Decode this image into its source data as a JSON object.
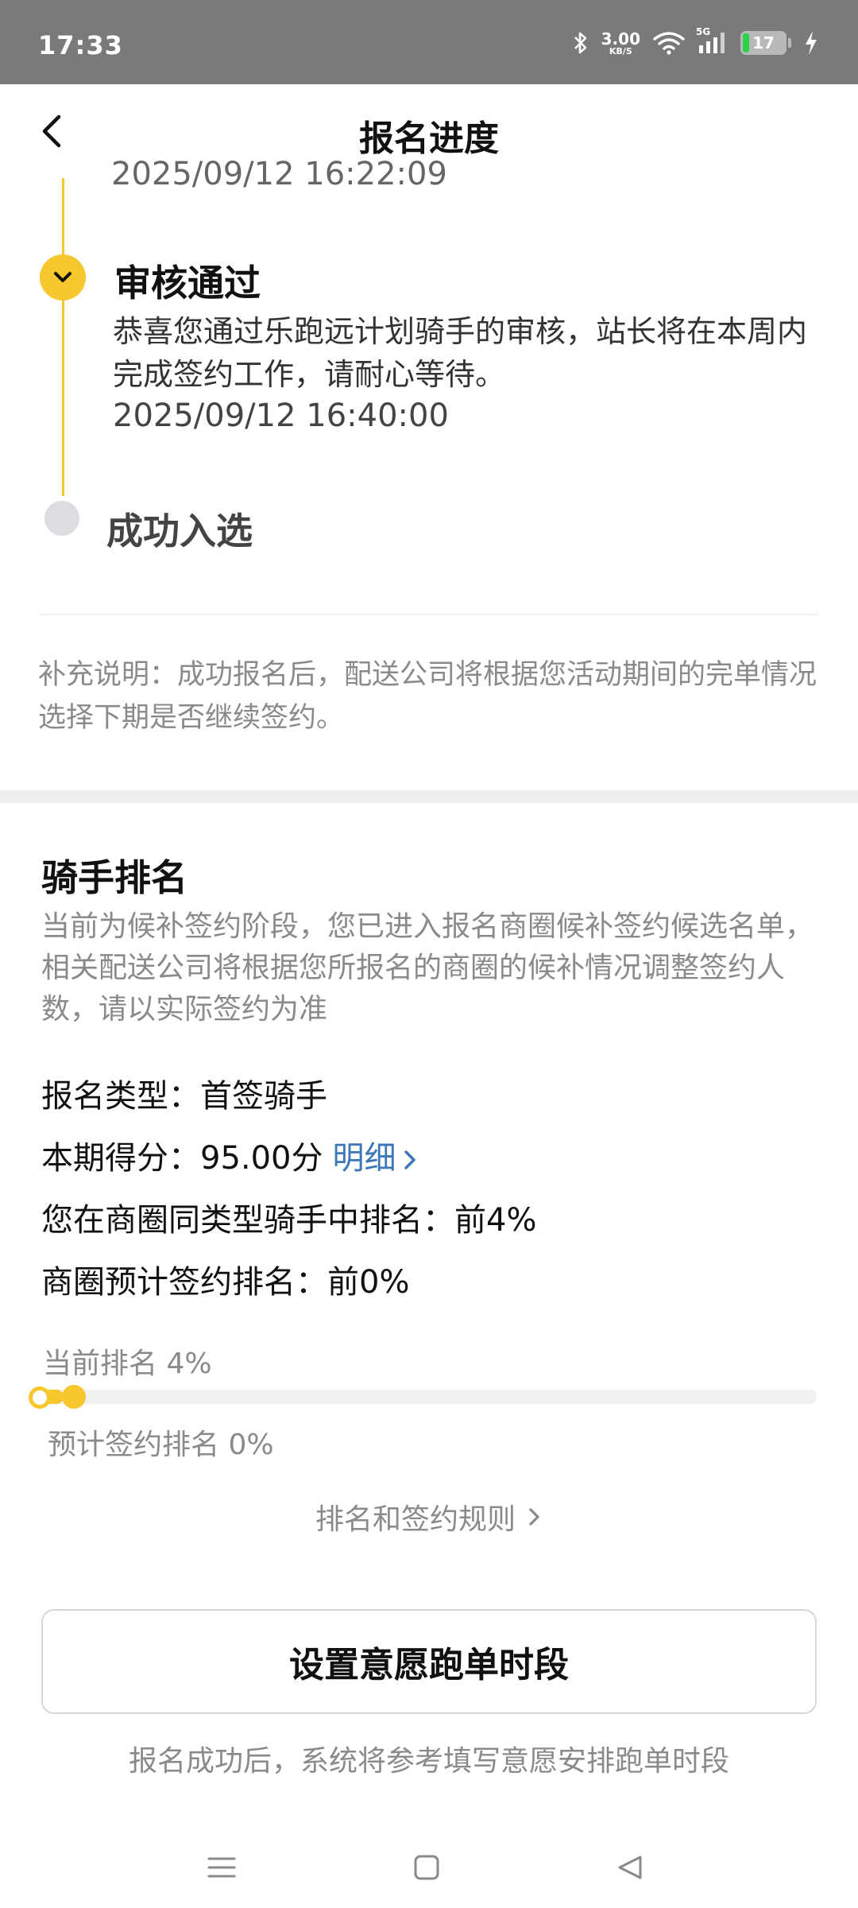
{
  "status_bar": {
    "time": "17:33",
    "net_speed_value": "3.00",
    "net_speed_unit": "KB/S",
    "network_type": "5G",
    "battery_level": "17"
  },
  "header": {
    "title": "报名进度"
  },
  "timeline": {
    "partial_prev_date": "2025/09/12 16:22:09",
    "steps": [
      {
        "title": "审核通过",
        "description": "恭喜您通过乐跑远计划骑手的审核，站长将在本周内完成签约工作，请耐心等待。",
        "date": "2025/09/12 16:40:00",
        "status": "done"
      },
      {
        "title": "成功入选",
        "status": "pending"
      }
    ]
  },
  "note": "补充说明：成功报名后，配送公司将根据您活动期间的完单情况选择下期是否继续签约。",
  "ranking": {
    "title": "骑手排名",
    "description": "当前为候补签约阶段，您已进入报名商圈候补签约候选名单，相关配送公司将根据您所报名的商圈的候补情况调整签约人数，请以实际签约为准",
    "signup_type": "报名类型：首签骑手",
    "score": "本期得分：95.00分",
    "detail_link": "明细",
    "rank_in_area": "您在商圈同类型骑手中排名：前4%",
    "estimated_sign_rank": "商圈预计签约排名：前0%",
    "current_rank_label": "当前排名 4%",
    "estimated_rank_label": "预计签约排名 0%",
    "current_rank_fraction": 0.04,
    "estimated_rank_fraction": 0.0,
    "rules_link": "排名和签约规则"
  },
  "actions": {
    "set_time_button": "设置意愿跑单时段",
    "hint": "报名成功后，系统将参考填写意愿安排跑单时段"
  },
  "colors": {
    "accent": "#f7c72e",
    "link": "#3c78b8",
    "muted_text": "#8a8a8a"
  }
}
